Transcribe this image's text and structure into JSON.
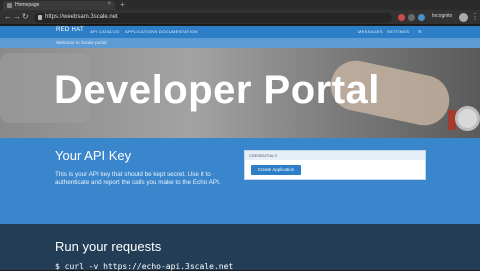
{
  "browser": {
    "tab_title": "Homepage",
    "url": "https://weebsam.3scale.net",
    "profile": "Incognito"
  },
  "site": {
    "brand": "RED HAT",
    "nav_left": [
      "API CATALOG",
      "APPLICATIONS",
      "DOCUMENTATION"
    ],
    "nav_right": [
      "MESSAGES",
      "SETTINGS"
    ],
    "banner_text": "Welcome to 3scale portal"
  },
  "hero": {
    "title": "Developer Portal"
  },
  "api_key": {
    "heading": "Your API Key",
    "description": "This is your API key that should be kept secret. Use it to authenticate and report the calls you make to the Echo API.",
    "panel_header": "CREDENTIALS",
    "create_button": "Create Application"
  },
  "requests": {
    "heading": "Run your requests",
    "code": "$ curl -v https://echo-api.3scale.net"
  },
  "colors": {
    "nav_blue": "#2c7ec6",
    "section_blue": "#3a86cc",
    "dark_section": "#233d57"
  }
}
